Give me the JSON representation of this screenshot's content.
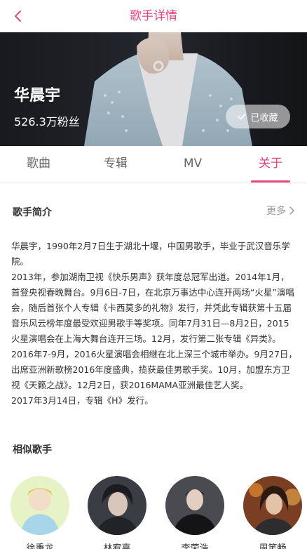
{
  "header": {
    "title": "歌手详情",
    "back_icon": "chevron-left-icon"
  },
  "banner": {
    "name": "华晨宇",
    "fans": "526.3万粉丝",
    "collect_label": "已收藏",
    "collect_icon": "check-icon"
  },
  "tabs": [
    {
      "label": "歌曲",
      "active": false
    },
    {
      "label": "专辑",
      "active": false
    },
    {
      "label": "MV",
      "active": false
    },
    {
      "label": "关于",
      "active": true
    }
  ],
  "intro": {
    "title": "歌手简介",
    "more": "更多",
    "paragraphs": [
      " 华晨宇，1990年2月7日生于湖北十堰，中国男歌手，毕业于武汉音乐学院。",
      "2013年，参加湖南卫视《快乐男声》获年度总冠军出道。2014年1月，首登央视春晚舞台。9月6日-7日，在北京万事达中心连开两场“火星”演唱会，随后首张个人专辑《卡西莫多的礼物》发行，并凭此专辑获第十五届音乐风云榜年度最受欢迎男歌手等奖项。同年7月31日—8月2日，2015火星演唱会在上海大舞台连开三场。12月，发行第二张专辑《异类》。",
      "2016年7-9月，2016火星演唱会相继在北上深三个城市举办。9月27日，出席亚洲新歌榜2016年度盛典，揽获最佳男歌手奖。10月，加盟东方卫视《天籁之战》。12月2日，获2016MAMA亚洲最佳艺人奖。",
      "2017年3月14日，专辑《H》发行。"
    ]
  },
  "similar": {
    "title": "相似歌手",
    "singers": [
      {
        "name": "徐秉龙"
      },
      {
        "name": "林宥嘉"
      },
      {
        "name": "李荣浩"
      },
      {
        "name": "周笔畅"
      }
    ]
  },
  "colors": {
    "accent": "#e8437a",
    "text": "#333333",
    "muted": "#999999"
  }
}
